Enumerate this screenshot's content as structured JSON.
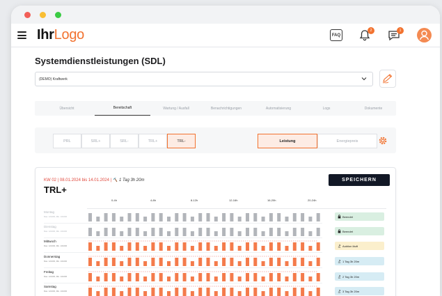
{
  "app": {
    "logo_part1": "Ihr",
    "logo_part2": "Logo",
    "faq_label": "FAQ",
    "bell_badge": "2",
    "chat_badge": "1"
  },
  "page": {
    "title": "Systemdienstleistungen (SDL)"
  },
  "plant_select": {
    "value": "(DEMO) Kraftwerk"
  },
  "tabs": [
    {
      "label": "Übersicht",
      "active": false
    },
    {
      "label": "Bereitschaft",
      "active": true
    },
    {
      "label": "Wartung / Ausfall",
      "active": false
    },
    {
      "label": "Benachrichtigungen",
      "active": false
    },
    {
      "label": "Automatisierung",
      "active": false
    },
    {
      "label": "Logs",
      "active": false
    },
    {
      "label": "Dokumente",
      "active": false
    }
  ],
  "products": [
    {
      "label": "PRL",
      "active": false
    },
    {
      "label": "SRL+",
      "active": false
    },
    {
      "label": "SRL-",
      "active": false
    },
    {
      "label": "TRL+",
      "active": false
    },
    {
      "label": "TRL-",
      "active": true
    }
  ],
  "modes": [
    {
      "label": "Leistung",
      "active": true
    },
    {
      "label": "Energiepreis",
      "active": false
    }
  ],
  "card": {
    "week": "KW 02 | 08.01.2024 bis 14.01.2024 |",
    "duration": "1 Tag 3h 20m",
    "title": "TRL+",
    "save_label": "SPEICHERN",
    "hours": [
      "0-4h",
      "4-8h",
      "8-12h",
      "12-16h",
      "16-20h",
      "20-24h"
    ],
    "rows": [
      {
        "day": "Montag",
        "sub": "Max. 121000, Min. 101000",
        "status": "Beendet",
        "status_type": "green",
        "status_icon": "lock-icon",
        "muted": true
      },
      {
        "day": "Dienstag",
        "sub": "Max. 121000, Min. 101000",
        "status": "Beendet",
        "status_type": "green",
        "status_icon": "lock-icon",
        "muted": true
      },
      {
        "day": "Mittwoch",
        "sub": "Max. 121000, Min. 101000",
        "status": "Auktion läuft",
        "status_type": "yellow",
        "status_icon": "gavel-icon",
        "muted": false
      },
      {
        "day": "Donnerstag",
        "sub": "Max. 121000, Min. 101000",
        "status": "1 Tag 3h 20m",
        "status_type": "blue",
        "status_icon": "gavel-icon",
        "muted": false
      },
      {
        "day": "Freitag",
        "sub": "Max. 121000, Min. 101000",
        "status": "2 Tag 3h 20m",
        "status_type": "blue",
        "status_icon": "gavel-icon",
        "muted": false
      },
      {
        "day": "Samstag",
        "sub": "Max. 121000, Min. 101000",
        "status": "3 Tag 3h 20m",
        "status_type": "blue",
        "status_icon": "gavel-icon",
        "muted": false
      }
    ]
  },
  "colors": {
    "accent": "#f2722f",
    "bar_active": "#f47b4b",
    "bar_muted": "#b2b5ba",
    "warning": "#e0463a"
  }
}
